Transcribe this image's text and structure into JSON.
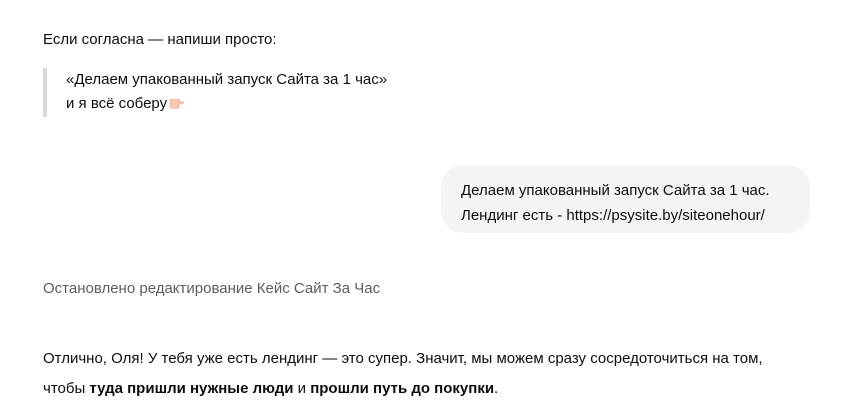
{
  "assistant_prev": {
    "intro": "Если согласна — напиши просто:",
    "quote_line1": "«Делаем упакованный запуск Сайта за 1 час»",
    "quote_line2": "и я всё соберу",
    "quote_icon": "pointing-hand-icon"
  },
  "user_message": {
    "line1": "Делаем упакованный запуск Сайта за 1 час.",
    "line2": "Лендинг есть - https://psysite.by/siteonehour/"
  },
  "status": {
    "text": "Остановлено редактирование Кейс Сайт За Час"
  },
  "assistant_reply": {
    "line1": "Отлично, Оля! У тебя уже есть лендинг — это супер. Значит, мы можем сразу сосредоточиться на том,",
    "line2_pre": "чтобы ",
    "line2_bold1": "туда пришли нужные люди",
    "line2_mid": " и ",
    "line2_bold2": "прошли путь до покупки",
    "line2_end": "."
  },
  "colors": {
    "bubble_bg": "#f4f4f4",
    "quote_bar": "#d9d9d9",
    "status_text": "#5d5d5d"
  }
}
